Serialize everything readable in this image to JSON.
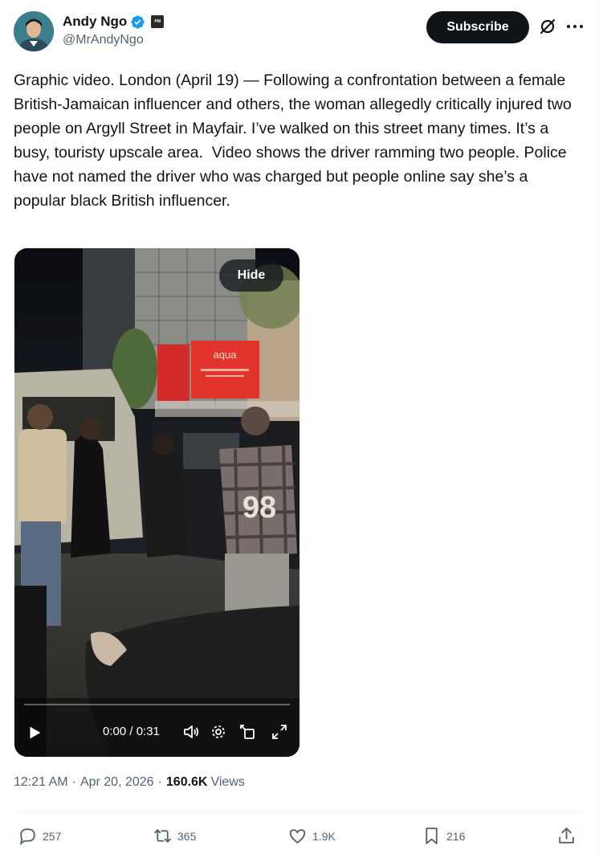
{
  "author": {
    "display_name": "Andy Ngo",
    "handle": "@MrAndyNgo",
    "verified": true,
    "affiliate_badge": "PM"
  },
  "header": {
    "subscribe_label": "Subscribe",
    "more_icon": "ellipsis-icon",
    "grok_icon": "grok-icon"
  },
  "tweet": {
    "text": "Graphic video. London (April 19) — Following a confrontation between a female British-Jamaican influencer and others, the woman allegedly critically injured two people on Argyll Street in Mayfair. I’ve walked on this street many times. It’s a busy, touristy upscale area.  Video shows the driver ramming two people. Police have not named the driver who was charged but people online say she’s a popular black British influencer."
  },
  "video": {
    "hide_label": "Hide",
    "time": "0:00 / 0:31",
    "sign_text": "aqua",
    "jersey_text": "98",
    "progress": 0
  },
  "meta": {
    "time": "12:21 AM",
    "date": "Apr 20, 2026",
    "views_count": "160.6K",
    "views_label": "Views"
  },
  "actions": {
    "replies": "257",
    "reposts": "365",
    "likes": "1.9K",
    "bookmarks": "216"
  },
  "colors": {
    "verified_blue": "#1d9bf0",
    "secondary_text": "#536471",
    "primary_text": "#0f1419"
  }
}
